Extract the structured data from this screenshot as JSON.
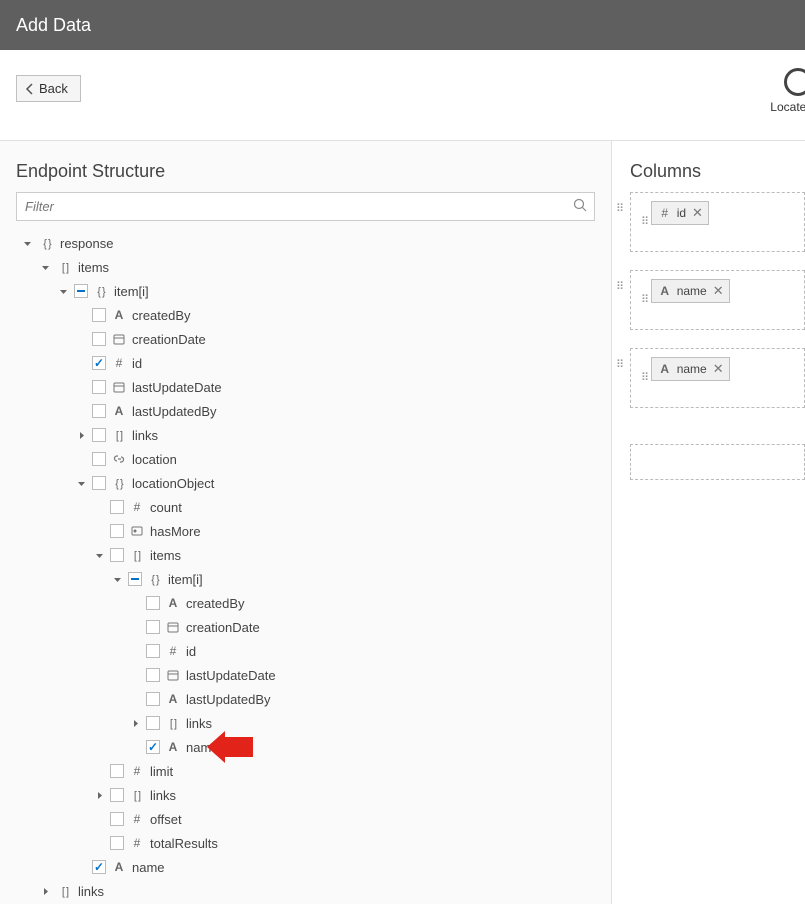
{
  "header": {
    "title": "Add Data"
  },
  "toolbar": {
    "back_label": "Back"
  },
  "wizard": {
    "step_label": "Locate Da"
  },
  "left": {
    "title": "Endpoint Structure",
    "filter_placeholder": "Filter"
  },
  "tree": {
    "root": "response",
    "items": "items",
    "item_i": "item[i]",
    "createdBy": "createdBy",
    "creationDate": "creationDate",
    "id": "id",
    "lastUpdateDate": "lastUpdateDate",
    "lastUpdatedBy": "lastUpdatedBy",
    "links": "links",
    "location": "location",
    "locationObject": "locationObject",
    "count": "count",
    "hasMore": "hasMore",
    "name": "name",
    "limit": "limit",
    "offset": "offset",
    "totalResults": "totalResults"
  },
  "right": {
    "title": "Columns",
    "chips": {
      "id": "id",
      "name1": "name",
      "name2": "name"
    }
  }
}
